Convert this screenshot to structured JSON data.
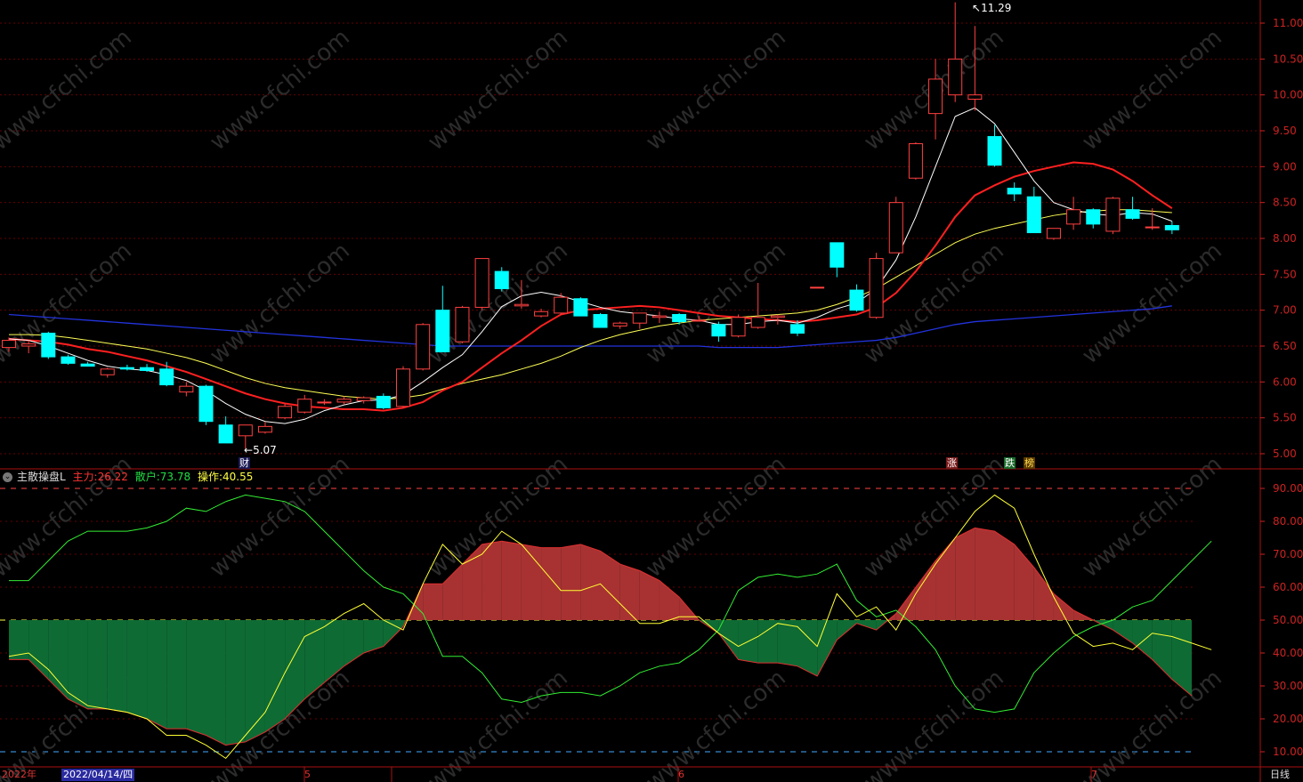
{
  "price_panel": {
    "high_marker": "11.29",
    "low_marker": "5.07",
    "y_ticks": [
      "11.00",
      "10.50",
      "10.00",
      "9.50",
      "9.00",
      "8.50",
      "8.00",
      "7.50",
      "7.00",
      "6.50",
      "6.00",
      "5.50",
      "5.00"
    ],
    "event_marks": [
      "财",
      "涨",
      "跌",
      "榜"
    ],
    "watermark": "www.cfchi.com"
  },
  "indicator_panel": {
    "name": "主散操盘L",
    "main_label": "主力:",
    "main_value": "26.22",
    "retail_label": "散户:",
    "retail_value": "73.78",
    "op_label": "操作:",
    "op_value": "40.55",
    "y_ticks": [
      "90.00",
      "80.00",
      "70.00",
      "60.00",
      "50.00",
      "40.00",
      "30.00",
      "20.00",
      "10.00"
    ]
  },
  "bottom_bar": {
    "year": "2022年",
    "cursor_date": "2022/04/14/四",
    "months": [
      "5",
      "6",
      "7"
    ],
    "period": "日线"
  },
  "colors": {
    "up": "#ff3232",
    "down": "#00ffff",
    "ma5": "#ffffff",
    "ma10": "#ff2020",
    "ma20": "#ffff55",
    "ma60": "#2233dd",
    "main": "#d23c3c",
    "retail": "#1aa55a",
    "op": "#ffff33",
    "grid": "#660000"
  },
  "chart_data": {
    "type": "candlestick",
    "ylim": [
      4.9,
      11.4
    ],
    "candles": [
      {
        "o": 6.48,
        "h": 6.62,
        "l": 6.42,
        "c": 6.58
      },
      {
        "o": 6.5,
        "h": 6.58,
        "l": 6.4,
        "c": 6.53
      },
      {
        "o": 6.68,
        "h": 6.7,
        "l": 6.32,
        "c": 6.35
      },
      {
        "o": 6.35,
        "h": 6.38,
        "l": 6.24,
        "c": 6.26
      },
      {
        "o": 6.25,
        "h": 6.28,
        "l": 6.22,
        "c": 6.22
      },
      {
        "o": 6.1,
        "h": 6.2,
        "l": 6.06,
        "c": 6.18
      },
      {
        "o": 6.2,
        "h": 6.24,
        "l": 6.16,
        "c": 6.18
      },
      {
        "o": 6.2,
        "h": 6.25,
        "l": 6.14,
        "c": 6.16
      },
      {
        "o": 6.18,
        "h": 6.28,
        "l": 5.94,
        "c": 5.96
      },
      {
        "o": 5.86,
        "h": 6.0,
        "l": 5.8,
        "c": 5.94
      },
      {
        "o": 5.94,
        "h": 5.96,
        "l": 5.4,
        "c": 5.45
      },
      {
        "o": 5.4,
        "h": 5.52,
        "l": 5.15,
        "c": 5.15
      },
      {
        "o": 5.25,
        "h": 5.4,
        "l": 5.07,
        "c": 5.4
      },
      {
        "o": 5.3,
        "h": 5.44,
        "l": 5.28,
        "c": 5.38
      },
      {
        "o": 5.5,
        "h": 5.7,
        "l": 5.48,
        "c": 5.66
      },
      {
        "o": 5.58,
        "h": 5.82,
        "l": 5.56,
        "c": 5.76
      },
      {
        "o": 5.72,
        "h": 5.76,
        "l": 5.68,
        "c": 5.72
      },
      {
        "o": 5.72,
        "h": 5.8,
        "l": 5.68,
        "c": 5.76
      },
      {
        "o": 5.74,
        "h": 5.8,
        "l": 5.7,
        "c": 5.78
      },
      {
        "o": 5.8,
        "h": 5.84,
        "l": 5.62,
        "c": 5.64
      },
      {
        "o": 5.66,
        "h": 6.22,
        "l": 5.64,
        "c": 6.18
      },
      {
        "o": 6.18,
        "h": 6.82,
        "l": 6.16,
        "c": 6.8
      },
      {
        "o": 7.0,
        "h": 7.34,
        "l": 6.42,
        "c": 6.42
      },
      {
        "o": 6.56,
        "h": 7.06,
        "l": 6.54,
        "c": 7.04
      },
      {
        "o": 7.04,
        "h": 7.72,
        "l": 7.0,
        "c": 7.72
      },
      {
        "o": 7.54,
        "h": 7.6,
        "l": 7.26,
        "c": 7.3
      },
      {
        "o": 7.06,
        "h": 7.42,
        "l": 7.02,
        "c": 7.08
      },
      {
        "o": 6.92,
        "h": 7.02,
        "l": 6.9,
        "c": 6.98
      },
      {
        "o": 6.96,
        "h": 7.24,
        "l": 6.94,
        "c": 7.18
      },
      {
        "o": 7.16,
        "h": 7.18,
        "l": 6.92,
        "c": 6.92
      },
      {
        "o": 6.94,
        "h": 6.96,
        "l": 6.76,
        "c": 6.76
      },
      {
        "o": 6.78,
        "h": 6.84,
        "l": 6.74,
        "c": 6.82
      },
      {
        "o": 6.82,
        "h": 6.96,
        "l": 6.74,
        "c": 6.96
      },
      {
        "o": 6.9,
        "h": 6.98,
        "l": 6.82,
        "c": 6.92
      },
      {
        "o": 6.94,
        "h": 6.96,
        "l": 6.8,
        "c": 6.84
      },
      {
        "o": 6.86,
        "h": 6.92,
        "l": 6.84,
        "c": 6.86
      },
      {
        "o": 6.8,
        "h": 6.84,
        "l": 6.56,
        "c": 6.64
      },
      {
        "o": 6.64,
        "h": 6.94,
        "l": 6.62,
        "c": 6.9
      },
      {
        "o": 6.76,
        "h": 7.38,
        "l": 6.74,
        "c": 6.9
      },
      {
        "o": 6.9,
        "h": 6.94,
        "l": 6.8,
        "c": 6.92
      },
      {
        "o": 6.8,
        "h": 6.86,
        "l": 6.64,
        "c": 6.68
      },
      {
        "o": 7.32,
        "h": 7.32,
        "l": 7.32,
        "c": 7.32
      },
      {
        "o": 7.94,
        "h": 7.94,
        "l": 7.46,
        "c": 7.6
      },
      {
        "o": 7.28,
        "h": 7.36,
        "l": 6.98,
        "c": 7.0
      },
      {
        "o": 6.9,
        "h": 7.8,
        "l": 6.88,
        "c": 7.72
      },
      {
        "o": 7.8,
        "h": 8.58,
        "l": 7.8,
        "c": 8.5
      },
      {
        "o": 8.84,
        "h": 9.34,
        "l": 8.82,
        "c": 9.32
      },
      {
        "o": 9.74,
        "h": 10.5,
        "l": 9.38,
        "c": 10.22
      },
      {
        "o": 10.0,
        "h": 11.29,
        "l": 9.9,
        "c": 10.5
      },
      {
        "o": 9.94,
        "h": 10.96,
        "l": 9.78,
        "c": 10.0
      },
      {
        "o": 9.42,
        "h": 9.58,
        "l": 9.0,
        "c": 9.02
      },
      {
        "o": 8.7,
        "h": 8.78,
        "l": 8.52,
        "c": 8.62
      },
      {
        "o": 8.58,
        "h": 8.72,
        "l": 8.08,
        "c": 8.08
      },
      {
        "o": 8.0,
        "h": 8.14,
        "l": 7.98,
        "c": 8.14
      },
      {
        "o": 8.2,
        "h": 8.58,
        "l": 8.12,
        "c": 8.4
      },
      {
        "o": 8.4,
        "h": 8.42,
        "l": 8.14,
        "c": 8.2
      },
      {
        "o": 8.1,
        "h": 8.58,
        "l": 8.06,
        "c": 8.56
      },
      {
        "o": 8.4,
        "h": 8.58,
        "l": 8.26,
        "c": 8.28
      },
      {
        "o": 8.16,
        "h": 8.42,
        "l": 8.12,
        "c": 8.16
      },
      {
        "o": 8.18,
        "h": 8.24,
        "l": 8.06,
        "c": 8.12
      }
    ],
    "ma5": [
      6.6,
      6.58,
      6.5,
      6.4,
      6.3,
      6.22,
      6.18,
      6.16,
      6.1,
      6.02,
      5.88,
      5.7,
      5.55,
      5.45,
      5.42,
      5.48,
      5.6,
      5.68,
      5.74,
      5.75,
      5.82,
      6.0,
      6.2,
      6.38,
      6.7,
      7.05,
      7.2,
      7.25,
      7.2,
      7.12,
      7.04,
      6.98,
      6.95,
      6.92,
      6.88,
      6.86,
      6.8,
      6.8,
      6.84,
      6.86,
      6.82,
      6.9,
      7.02,
      7.1,
      7.3,
      7.7,
      8.3,
      9.0,
      9.7,
      9.82,
      9.6,
      9.2,
      8.8,
      8.5,
      8.4,
      8.34,
      8.32,
      8.36,
      8.34,
      8.24
    ],
    "ma10": [
      6.6,
      6.58,
      6.56,
      6.52,
      6.46,
      6.42,
      6.36,
      6.3,
      6.22,
      6.14,
      6.04,
      5.94,
      5.84,
      5.76,
      5.7,
      5.66,
      5.64,
      5.62,
      5.62,
      5.6,
      5.64,
      5.72,
      5.88,
      6.0,
      6.2,
      6.4,
      6.58,
      6.78,
      6.94,
      7.0,
      7.02,
      7.04,
      7.06,
      7.04,
      7.0,
      6.96,
      6.92,
      6.9,
      6.88,
      6.86,
      6.84,
      6.86,
      6.9,
      6.94,
      7.04,
      7.24,
      7.54,
      7.9,
      8.3,
      8.6,
      8.74,
      8.86,
      8.94,
      9.0,
      9.06,
      9.04,
      8.96,
      8.8,
      8.6,
      8.42
    ],
    "ma20": [
      6.66,
      6.66,
      6.65,
      6.62,
      6.58,
      6.54,
      6.5,
      6.46,
      6.4,
      6.34,
      6.26,
      6.16,
      6.06,
      5.98,
      5.92,
      5.88,
      5.84,
      5.8,
      5.78,
      5.76,
      5.78,
      5.82,
      5.9,
      5.98,
      6.04,
      6.1,
      6.18,
      6.26,
      6.36,
      6.48,
      6.58,
      6.66,
      6.72,
      6.78,
      6.82,
      6.86,
      6.88,
      6.9,
      6.92,
      6.94,
      6.96,
      7.0,
      7.08,
      7.18,
      7.3,
      7.46,
      7.62,
      7.78,
      7.94,
      8.06,
      8.14,
      8.2,
      8.26,
      8.32,
      8.36,
      8.38,
      8.4,
      8.4,
      8.38,
      8.36
    ],
    "ma60": [
      6.94,
      6.92,
      6.9,
      6.88,
      6.86,
      6.84,
      6.82,
      6.8,
      6.78,
      6.76,
      6.74,
      6.72,
      6.7,
      6.68,
      6.66,
      6.64,
      6.62,
      6.6,
      6.58,
      6.56,
      6.54,
      6.52,
      6.5,
      6.5,
      6.5,
      6.5,
      6.5,
      6.5,
      6.5,
      6.5,
      6.5,
      6.5,
      6.5,
      6.5,
      6.5,
      6.5,
      6.48,
      6.48,
      6.48,
      6.48,
      6.5,
      6.52,
      6.54,
      6.56,
      6.58,
      6.62,
      6.68,
      6.74,
      6.8,
      6.84,
      6.86,
      6.88,
      6.9,
      6.92,
      6.94,
      6.96,
      6.98,
      7.0,
      7.02,
      7.06
    ],
    "indicator": {
      "ylim": [
        5,
        95
      ],
      "main": [
        38,
        38,
        32,
        26,
        23,
        23,
        22,
        20,
        17,
        17,
        15,
        12,
        13,
        16,
        20,
        26,
        31,
        36,
        40,
        42,
        48,
        61,
        61,
        67,
        73,
        74,
        73,
        72,
        72,
        73,
        71,
        67,
        65,
        62,
        57,
        50,
        46,
        38,
        37,
        37,
        36,
        33,
        44,
        49,
        47,
        52,
        60,
        68,
        75,
        78,
        77,
        73,
        66,
        58,
        53,
        50,
        47,
        43,
        38,
        32,
        27
      ],
      "retail": [
        62,
        62,
        68,
        74,
        77,
        77,
        77,
        78,
        80,
        84,
        83,
        86,
        88,
        87,
        86,
        83,
        77,
        71,
        65,
        60,
        58,
        52,
        39,
        39,
        34,
        26,
        25,
        27,
        28,
        28,
        27,
        30,
        34,
        36,
        37,
        41,
        47,
        59,
        63,
        64,
        63,
        64,
        67,
        56,
        51,
        53,
        48,
        41,
        30,
        23,
        22,
        23,
        34,
        40,
        45,
        48,
        50,
        54,
        56,
        62,
        68,
        74
      ],
      "op": [
        39,
        40,
        35,
        28,
        24,
        23,
        22,
        20,
        15,
        15,
        12,
        8,
        15,
        22,
        34,
        45,
        48,
        52,
        55,
        50,
        47,
        61,
        73,
        67,
        70,
        77,
        73,
        66,
        59,
        59,
        61,
        55,
        49,
        49,
        51,
        51,
        46,
        42,
        45,
        49,
        48,
        42,
        58,
        51,
        54,
        47,
        58,
        67,
        75,
        83,
        88,
        84,
        70,
        57,
        46,
        42,
        43,
        41,
        46,
        45,
        43,
        41
      ]
    }
  }
}
